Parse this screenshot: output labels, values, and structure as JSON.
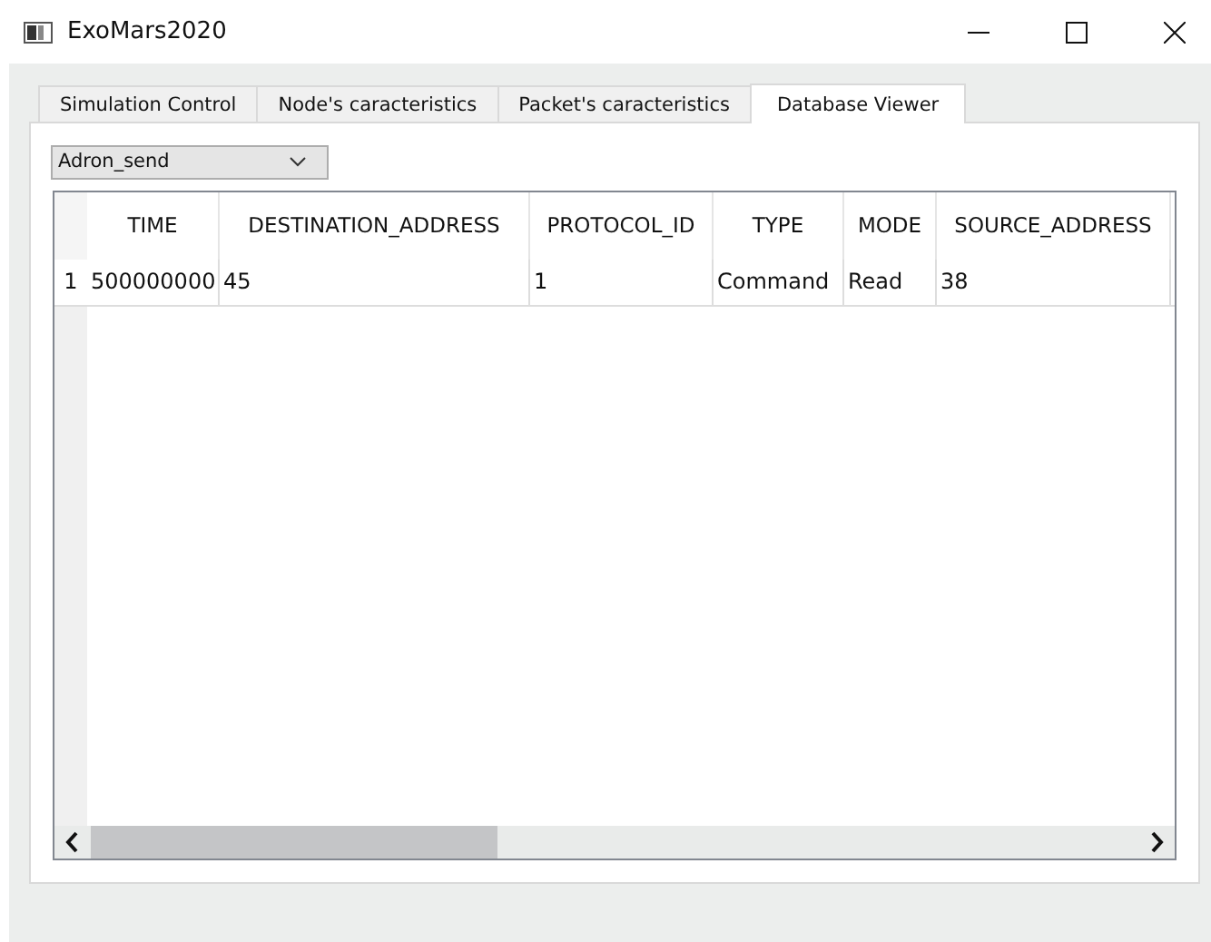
{
  "window": {
    "title": "ExoMars2020"
  },
  "tabs": [
    {
      "label": "Simulation Control",
      "selected": false
    },
    {
      "label": "Node's caracteristics",
      "selected": false
    },
    {
      "label": "Packet's caracteristics",
      "selected": false
    },
    {
      "label": "Database Viewer",
      "selected": true
    }
  ],
  "table_select": {
    "value": "Adron_send"
  },
  "table": {
    "columns": [
      "TIME",
      "DESTINATION_ADDRESS",
      "PROTOCOL_ID",
      "TYPE",
      "MODE",
      "SOURCE_ADDRESS"
    ],
    "rows": [
      {
        "number": "1",
        "cells": [
          "500000000",
          "45",
          "1",
          "Command",
          "Read",
          "38"
        ]
      }
    ]
  }
}
